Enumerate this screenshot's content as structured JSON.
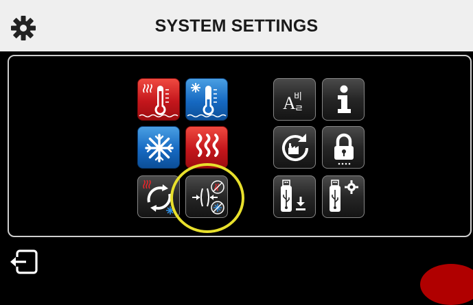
{
  "header": {
    "title": "SYSTEM SETTINGS",
    "icon": "gear-icon"
  },
  "tiles": [
    {
      "name": "heating-setpoint-tile",
      "icon": "heat-thermometer-icon",
      "color": "red"
    },
    {
      "name": "cooling-setpoint-tile",
      "icon": "cold-thermometer-icon",
      "color": "blue"
    },
    {
      "name": "cooling-mode-tile",
      "icon": "snowflake-icon",
      "color": "blue"
    },
    {
      "name": "heating-mode-tile",
      "icon": "heat-waves-icon",
      "color": "red"
    },
    {
      "name": "auto-changeover-tile",
      "icon": "heat-cool-cycle-icon",
      "color": "dark"
    },
    {
      "name": "deadband-tile",
      "icon": "deadband-icon",
      "color": "dark",
      "highlighted": true
    },
    {
      "name": "language-tile",
      "icon": "language-icon",
      "color": "dark"
    },
    {
      "name": "info-tile",
      "icon": "info-icon",
      "color": "dark"
    },
    {
      "name": "factory-reset-tile",
      "icon": "factory-reset-icon",
      "color": "dark"
    },
    {
      "name": "lock-tile",
      "icon": "lock-icon",
      "color": "dark"
    },
    {
      "name": "usb-download-tile",
      "icon": "usb-download-icon",
      "color": "dark"
    },
    {
      "name": "usb-settings-tile",
      "icon": "usb-settings-icon",
      "color": "dark"
    }
  ],
  "footer": {
    "exit_icon": "exit-icon"
  },
  "colors": {
    "header_bg": "#efefef",
    "red_tile": "#c4161c",
    "blue_tile": "#1669c2",
    "dark_tile": "#262626",
    "highlight": "#e8e02c"
  }
}
